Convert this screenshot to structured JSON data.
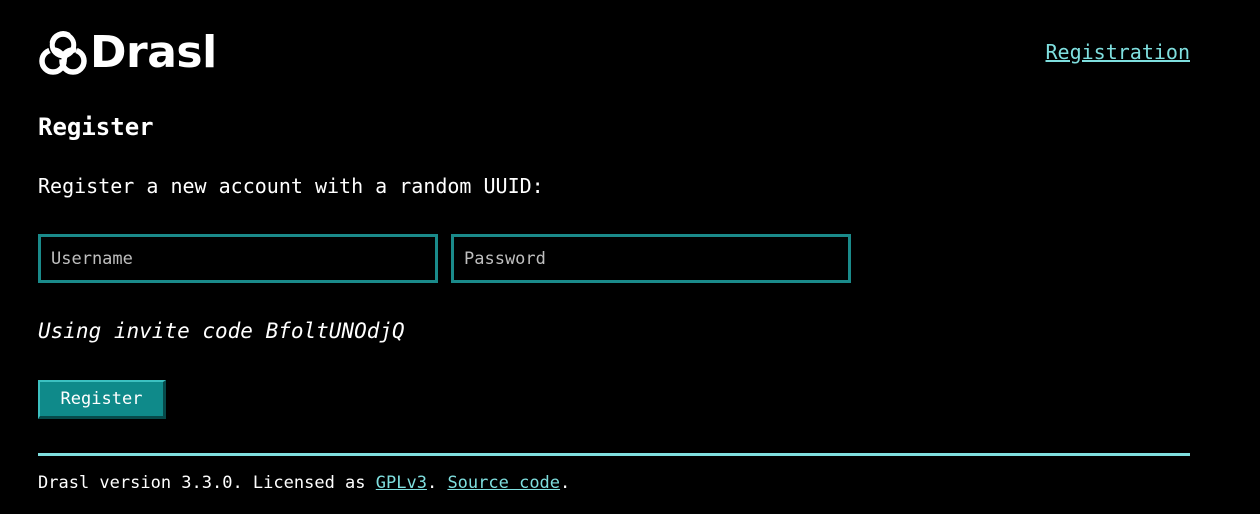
{
  "header": {
    "logo_text": "Drasl",
    "logo_icon": "drasl-knot-logo",
    "nav_link": "Registration"
  },
  "main": {
    "title": "Register",
    "intro": "Register a new account with a random UUID:",
    "username_placeholder": "Username",
    "password_placeholder": "Password",
    "username_value": "",
    "password_value": "",
    "invite_text": "Using invite code BfoltUNOdjQ",
    "register_button": "Register"
  },
  "footer": {
    "prefix": "Drasl version 3.3.0. Licensed as ",
    "license_link": "GPLv3",
    "middle": ". ",
    "source_link": "Source code",
    "suffix": "."
  },
  "colors": {
    "background": "#000000",
    "accent": "#0f8a8a",
    "link": "#7fdfdf",
    "text": "#ffffff"
  }
}
